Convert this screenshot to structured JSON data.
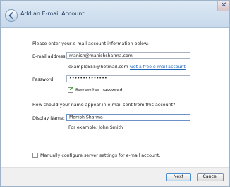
{
  "window": {
    "title": "Add an E-mail Account",
    "close_glyph": "✕",
    "back_icon": "back-arrow-icon",
    "close_icon": "close-icon"
  },
  "form": {
    "intro_text": "Please enter your e-mail account information below:",
    "email_label": "E-mail address:",
    "email_value": "manish@manishsharma.com",
    "email_example": "example555@hotmail.com",
    "free_account_link": "Get a free e-mail account",
    "password_label": "Password:",
    "password_value": "••••••••••••••",
    "remember_password_label": "Remember password",
    "remember_password_checked": true,
    "name_question": "How should your name appear in e-mail sent from this account?",
    "display_name_label": "Display Name:",
    "display_name_value": "Manish Sharma",
    "display_name_example": "For example: John Smith",
    "manual_config_label": "Manually configure server settings for e-mail account.",
    "manual_config_checked": false,
    "checkmark_glyph": "✔"
  },
  "buttons": {
    "next": "Next",
    "cancel": "Cancel"
  },
  "colors": {
    "link": "#1e63b6",
    "titlebar": "#c7d9ec",
    "check": "#21a121"
  }
}
